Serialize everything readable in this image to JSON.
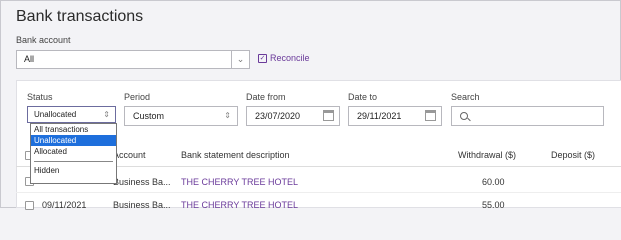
{
  "page": {
    "title": "Bank transactions"
  },
  "bank_account": {
    "label": "Bank account",
    "value": "All"
  },
  "reconcile": {
    "label": "Reconcile"
  },
  "filters": {
    "status": {
      "label": "Status",
      "value": "Unallocated",
      "options": [
        "All transactions",
        "Unallocated",
        "Allocated",
        "Hidden"
      ]
    },
    "period": {
      "label": "Period",
      "value": "Custom"
    },
    "date_from": {
      "label": "Date from",
      "value": "23/07/2020"
    },
    "date_to": {
      "label": "Date to",
      "value": "29/11/2021"
    },
    "search": {
      "label": "Search",
      "value": ""
    }
  },
  "table": {
    "columns": {
      "account": "Account",
      "description": "Bank statement description",
      "withdrawal": "Withdrawal ($)",
      "deposit": "Deposit ($)"
    },
    "rows": [
      {
        "date": "",
        "account": "Business Ba...",
        "description": "THE CHERRY TREE HOTEL",
        "withdrawal": "60.00",
        "deposit": ""
      },
      {
        "date": "09/11/2021",
        "account": "Business Ba...",
        "description": "THE CHERRY TREE HOTEL",
        "withdrawal": "55.00",
        "deposit": ""
      }
    ]
  },
  "colors": {
    "accent": "#6a3a9a",
    "selected": "#1e6fdc"
  }
}
